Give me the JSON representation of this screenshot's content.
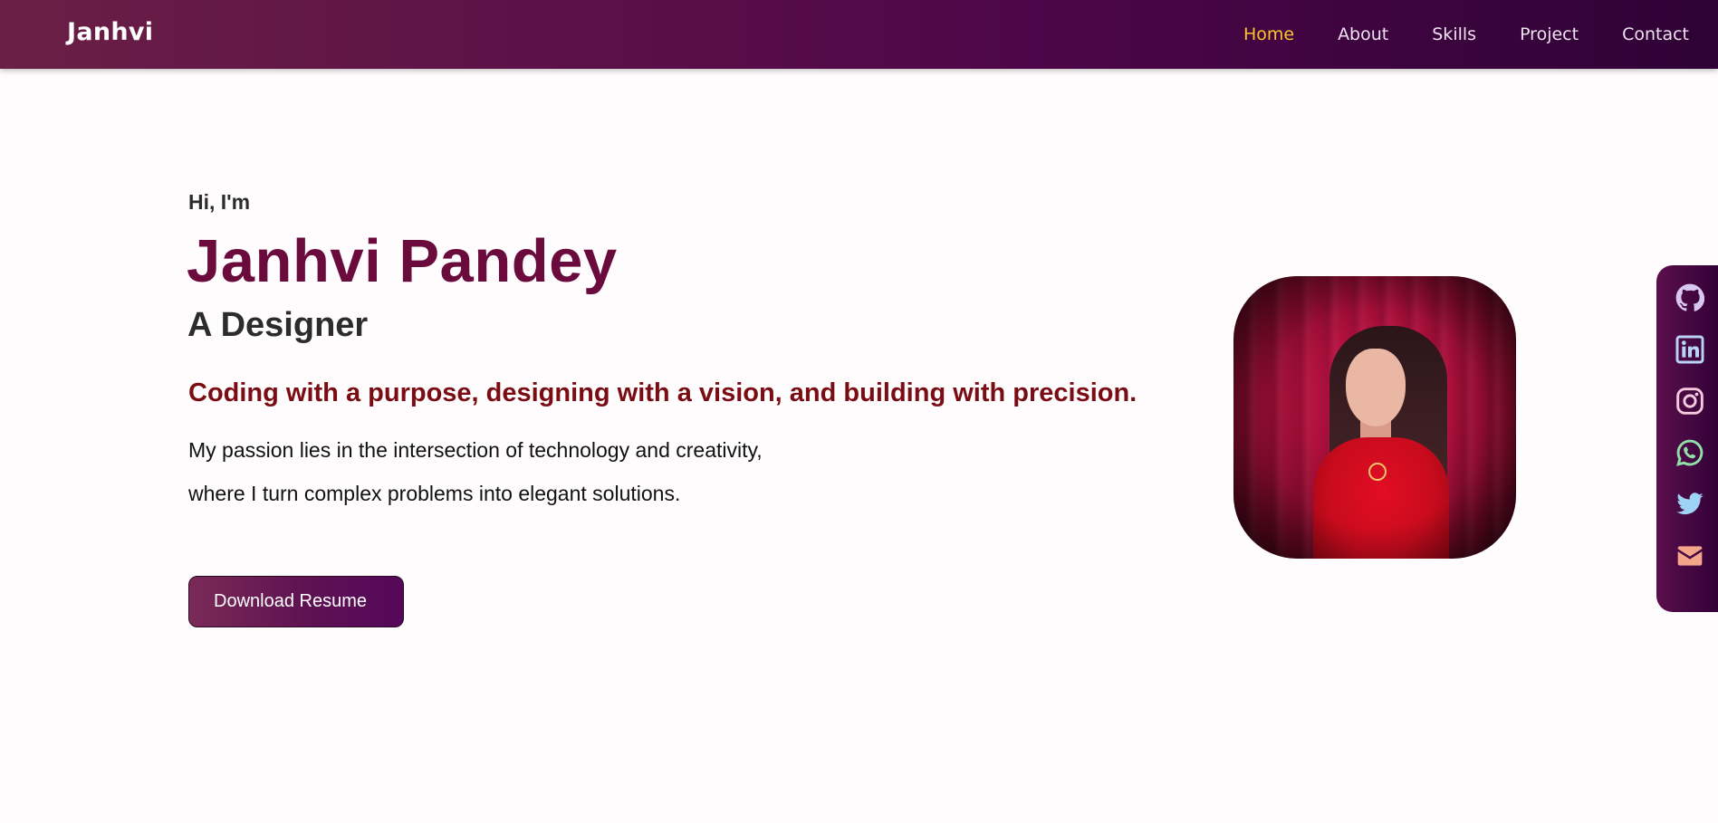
{
  "header": {
    "brand": "Janhvi",
    "nav": [
      {
        "label": "Home",
        "active": true
      },
      {
        "label": "About",
        "active": false
      },
      {
        "label": "Skills",
        "active": false
      },
      {
        "label": "Project",
        "active": false
      },
      {
        "label": "Contact",
        "active": false
      }
    ]
  },
  "hero": {
    "greeting": "Hi, I'm",
    "name": "Janhvi Pandey",
    "role": "A Designer",
    "tagline": "Coding with a purpose, designing with a vision, and building with precision.",
    "description_line1": "My passion lies in the intersection of technology and creativity,",
    "description_line2": "where I turn complex problems into elegant solutions.",
    "resume_button": "Download Resume"
  },
  "social": [
    {
      "icon": "github-icon",
      "color": "#d8c7ef"
    },
    {
      "icon": "linkedin-icon",
      "color": "#b9d3f7"
    },
    {
      "icon": "instagram-icon",
      "color": "#f3c9dc"
    },
    {
      "icon": "whatsapp-icon",
      "color": "#8fe0a6"
    },
    {
      "icon": "twitter-icon",
      "color": "#9fd3f5"
    },
    {
      "icon": "mail-icon",
      "color": "#f4a68a"
    }
  ],
  "colors": {
    "accent_active_nav": "#ffc329",
    "name_color": "#6b0a3c",
    "tagline_color": "#7a0d14",
    "header_gradient_start": "#6a1f45",
    "header_gradient_end": "#2e0235"
  }
}
